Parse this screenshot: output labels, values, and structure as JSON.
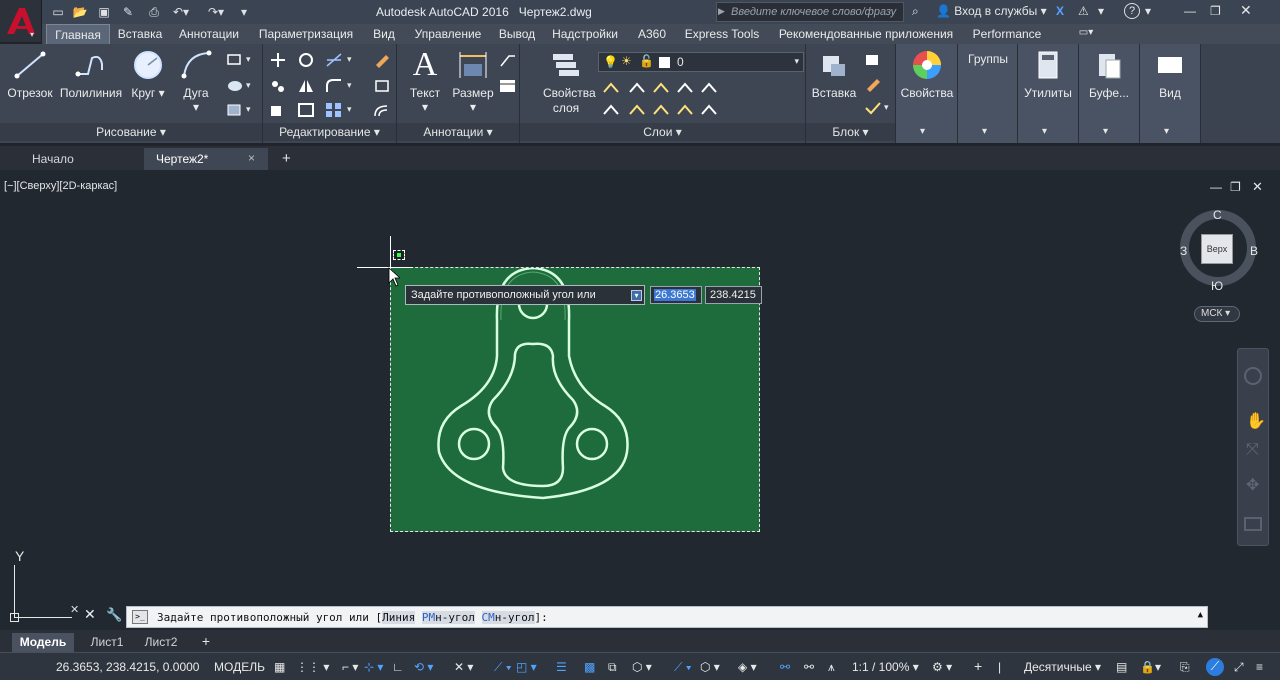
{
  "app": {
    "title": "Autodesk AutoCAD 2016",
    "document": "Чертеж2.dwg",
    "search_placeholder": "Введите ключевое слово/фразу",
    "signin": "Вход в службы",
    "help": "?"
  },
  "ribbon_tabs": [
    "Главная",
    "Вставка",
    "Аннотации",
    "Параметризация",
    "Вид",
    "Управление",
    "Вывод",
    "Надстройки",
    "A360",
    "Express Tools",
    "Рекомендованные приложения",
    "Performance"
  ],
  "ribbon": {
    "draw": {
      "title": "Рисование",
      "line": "Отрезок",
      "polyline": "Полилиния",
      "circle": "Круг",
      "arc": "Дуга"
    },
    "modify": {
      "title": "Редактирование"
    },
    "annotation": {
      "title": "Аннотации",
      "text": "Текст",
      "dimension": "Размер"
    },
    "layers": {
      "title": "Слои",
      "properties": "Свойства слоя",
      "current_layer": "0"
    },
    "block": {
      "title": "Блок",
      "insert": "Вставка"
    },
    "properties": {
      "label": "Свойства"
    },
    "groups": {
      "label": "Группы"
    },
    "utilities": {
      "label": "Утилиты"
    },
    "clipboard": {
      "label": "Буфе..."
    },
    "view": {
      "label": "Вид"
    }
  },
  "doc_tabs": {
    "start": "Начало",
    "drawing": "Чертеж2*",
    "close": "×",
    "add": "+"
  },
  "viewport": {
    "label": "[−][Сверху][2D-каркас]",
    "prompt": "Задайте противоположный угол или",
    "input_x": "26.3653",
    "input_y": "238.4215",
    "ucs_y": "Y"
  },
  "viewcube": {
    "north": "С",
    "south": "Ю",
    "west": "З",
    "east": "В",
    "face": "Верх",
    "ucs": "МСК"
  },
  "command": {
    "prefix": "Задайте противоположный угол или [",
    "opt1_hot": "",
    "opt1": "Линия",
    "opt2_hot": "РМ",
    "opt2": "н-угол",
    "opt3_hot": "СМ",
    "opt3": "н-угол",
    "suffix": "]:"
  },
  "layout_tabs": {
    "model": "Модель",
    "sheet1": "Лист1",
    "sheet2": "Лист2",
    "add": "+"
  },
  "status": {
    "coords": "26.3653, 238.4215, 0.0000",
    "space": "МОДЕЛЬ",
    "scale": "1:1 / 100%",
    "units": "Десятичные"
  },
  "colors": {
    "sheet": "#1e6b3b",
    "shape": "#d8ffe0",
    "accent": "#c8102e"
  }
}
